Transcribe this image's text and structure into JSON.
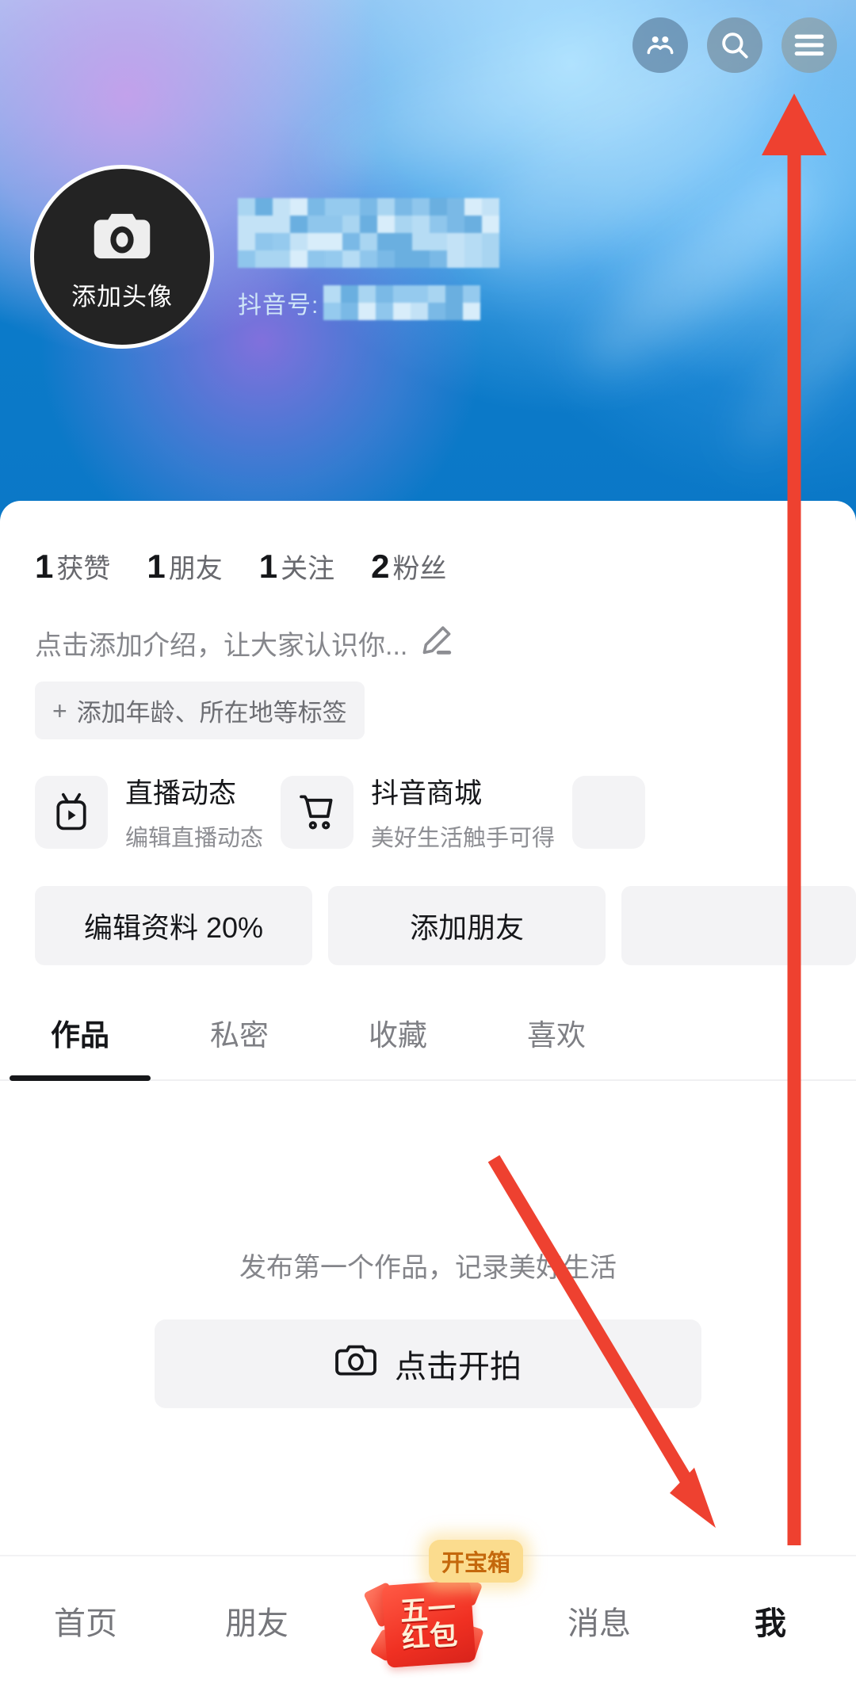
{
  "header": {
    "actions": [
      {
        "name": "friends-icon",
        "label": "好友"
      },
      {
        "name": "search-icon",
        "label": "搜索"
      },
      {
        "name": "menu-icon",
        "label": "菜单"
      }
    ],
    "avatar": {
      "label": "添加头像",
      "icon": "camera-icon"
    },
    "identity": {
      "username_masked": "",
      "id_label": "抖音号:",
      "id_masked": ""
    }
  },
  "stats": [
    {
      "num": "1",
      "label": "获赞"
    },
    {
      "num": "1",
      "label": "朋友"
    },
    {
      "num": "1",
      "label": "关注"
    },
    {
      "num": "2",
      "label": "粉丝"
    }
  ],
  "bio": {
    "placeholder": "点击添加介绍，让大家认识你...",
    "edit_icon": "pencil-icon",
    "tag_plus": "+",
    "tag_label": "添加年龄、所在地等标签"
  },
  "cards": [
    {
      "title": "直播动态",
      "subtitle": "编辑直播动态",
      "icon": "tv-icon"
    },
    {
      "title": "抖音商城",
      "subtitle": "美好生活触手可得",
      "icon": "cart-icon"
    },
    {
      "title": "",
      "subtitle": "",
      "icon": "partial-card-icon"
    }
  ],
  "actions": {
    "edit_profile": "编辑资料 20%",
    "add_friend": "添加朋友"
  },
  "tabs": [
    {
      "label": "作品",
      "active": true
    },
    {
      "label": "私密",
      "active": false
    },
    {
      "label": "收藏",
      "active": false
    },
    {
      "label": "喜欢",
      "active": false
    }
  ],
  "empty_state": {
    "message": "发布第一个作品，记录美好生活",
    "button_label": "点击开拍",
    "button_icon": "camera-icon"
  },
  "bottom_nav": {
    "items": [
      {
        "label": "首页",
        "active": false
      },
      {
        "label": "朋友",
        "active": false
      },
      {
        "label": "消息",
        "active": false
      },
      {
        "label": "我",
        "active": true
      }
    ],
    "hongbao": {
      "line1": "五一",
      "line2": "红包",
      "badge": "开宝箱"
    }
  },
  "annotations": {
    "arrow_color": "#ee4130",
    "arrow_up_target": "menu-icon",
    "arrow_diagonal_target": "点击开拍"
  },
  "colors": {
    "cover_blue": "#0b78c7",
    "cover_purple": "#9e6ee1",
    "accent_red": "#ee4130",
    "badge_yellow": "#fbdc8e",
    "text_dark": "#16171a",
    "text_muted": "#84858a",
    "chip_bg": "#f3f3f5"
  }
}
